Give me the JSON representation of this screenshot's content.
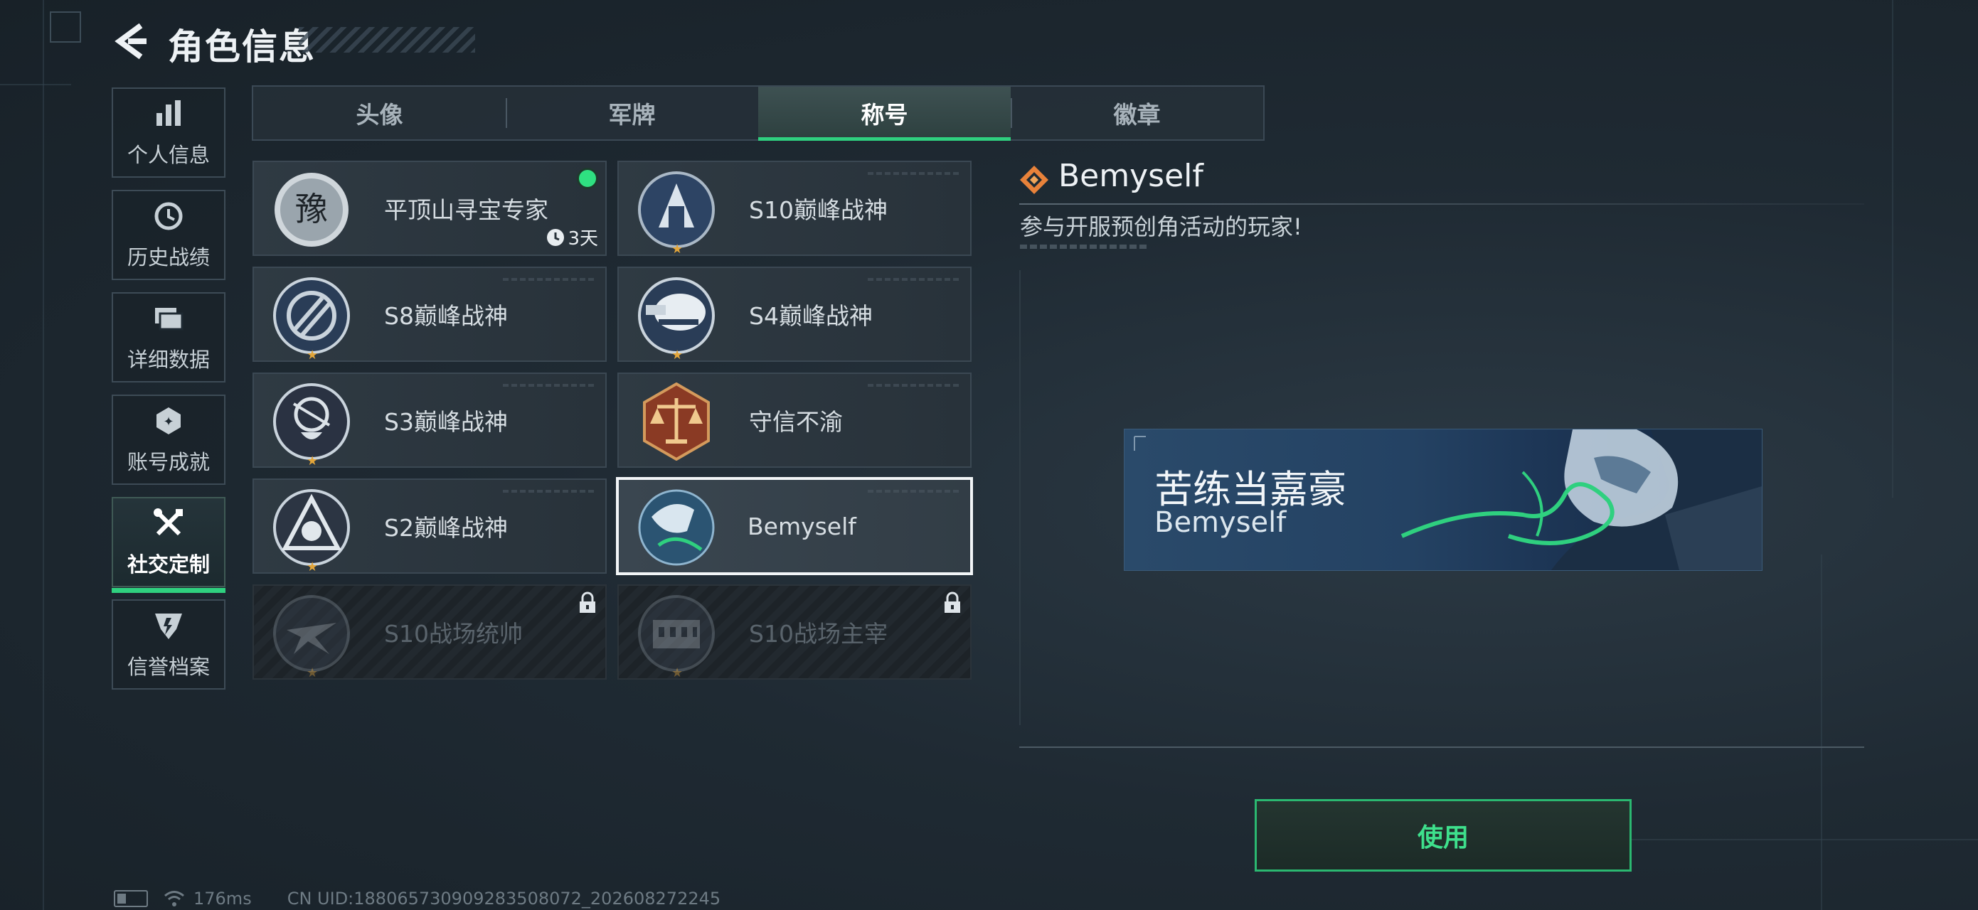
{
  "header": {
    "title": "角色信息"
  },
  "sidebar": {
    "items": [
      {
        "label": "个人信息",
        "icon": "bar-chart-icon"
      },
      {
        "label": "历史战绩",
        "icon": "clock-history-icon"
      },
      {
        "label": "详细数据",
        "icon": "folder-icon"
      },
      {
        "label": "账号成就",
        "icon": "medal-icon"
      },
      {
        "label": "社交定制",
        "icon": "tools-icon",
        "active": true
      },
      {
        "label": "信誉档案",
        "icon": "shield-icon"
      }
    ]
  },
  "tabs": [
    {
      "label": "头像"
    },
    {
      "label": "军牌"
    },
    {
      "label": "称号",
      "active": true
    },
    {
      "label": "徽章"
    }
  ],
  "titles": [
    {
      "name": "平顶山寻宝专家",
      "timer": "3天",
      "equipped": true
    },
    {
      "name": "S10巅峰战神"
    },
    {
      "name": "S8巅峰战神"
    },
    {
      "name": "S4巅峰战神"
    },
    {
      "name": "S3巅峰战神"
    },
    {
      "name": "守信不渝"
    },
    {
      "name": "S2巅峰战神"
    },
    {
      "name": "Bemyself",
      "selected": true
    },
    {
      "name": "S10战场统帅",
      "locked": true
    },
    {
      "name": "S10战场主宰",
      "locked": true
    }
  ],
  "detail": {
    "name": "Bemyself",
    "description": "参与开服预创角活动的玩家!",
    "banner": {
      "title": "苦练当嘉豪",
      "subtitle": "Bemyself"
    },
    "use_label": "使用"
  },
  "footer": {
    "ping": "176ms",
    "uid": "CN UID:18806573090928350807​2_202608272245"
  },
  "colors": {
    "accent": "#2fd07f",
    "bg": "#1f2a33",
    "star": "#e2a53a"
  }
}
